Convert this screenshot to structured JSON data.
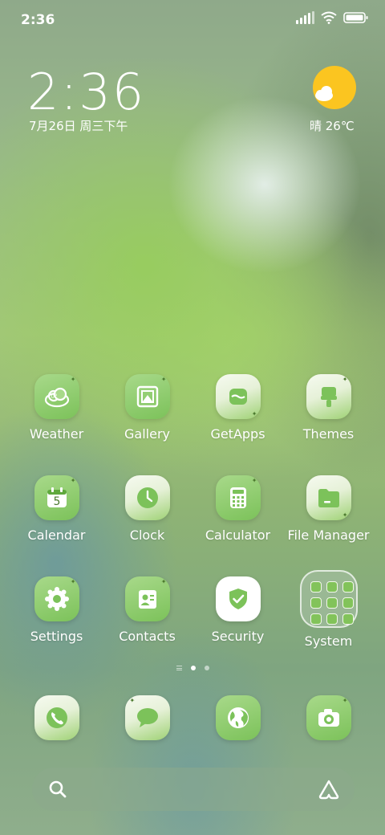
{
  "status_bar": {
    "time": "2:36",
    "icons": [
      "signal-icon",
      "wifi-icon",
      "battery-icon"
    ]
  },
  "lock_widget": {
    "clock": "2:36",
    "date": "7月26日 周三下午",
    "weather": "晴 26℃",
    "weather_icon": "sun-cloud-icon"
  },
  "apps": [
    {
      "label": "Weather",
      "icon": "weather-icon",
      "icon_text": "0°"
    },
    {
      "label": "Gallery",
      "icon": "gallery-icon"
    },
    {
      "label": "GetApps",
      "icon": "getapps-icon"
    },
    {
      "label": "Themes",
      "icon": "themes-icon"
    },
    {
      "label": "Calendar",
      "icon": "calendar-icon",
      "icon_text": "5"
    },
    {
      "label": "Clock",
      "icon": "clock-icon"
    },
    {
      "label": "Calculator",
      "icon": "calculator-icon"
    },
    {
      "label": "File Manager",
      "icon": "file-manager-icon"
    },
    {
      "label": "Settings",
      "icon": "settings-icon"
    },
    {
      "label": "Contacts",
      "icon": "contacts-icon"
    },
    {
      "label": "Security",
      "icon": "security-icon"
    },
    {
      "label": "System",
      "icon": "folder-icon"
    }
  ],
  "dock": [
    {
      "name": "phone",
      "icon": "phone-icon"
    },
    {
      "name": "messages",
      "icon": "messages-icon"
    },
    {
      "name": "browser",
      "icon": "browser-icon"
    },
    {
      "name": "camera",
      "icon": "camera-icon"
    }
  ],
  "search": {
    "icon": "search-icon",
    "assistant_icon": "assistant-icon"
  },
  "colors": {
    "accent_green": "#7cc25a",
    "sun": "#fbc520"
  }
}
